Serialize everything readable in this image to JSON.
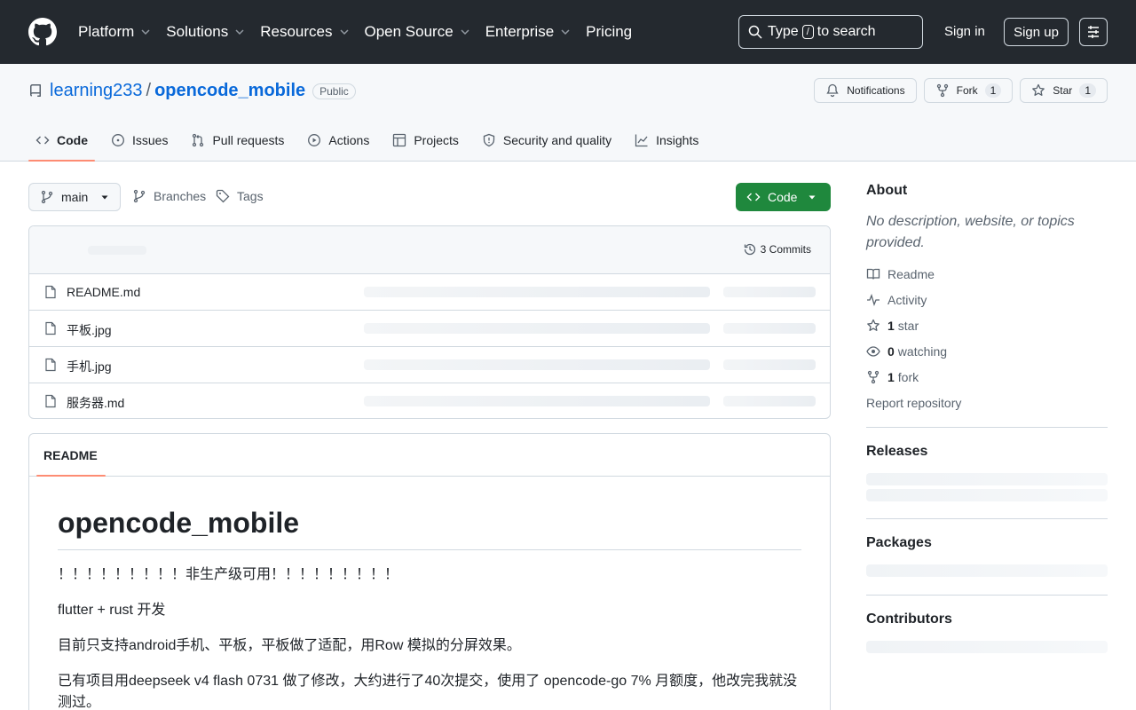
{
  "header": {
    "nav": [
      "Platform",
      "Solutions",
      "Resources",
      "Open Source",
      "Enterprise",
      "Pricing"
    ],
    "nav_has_caret": [
      true,
      true,
      true,
      true,
      true,
      false
    ],
    "search_prefix": "Type",
    "search_key": "/",
    "search_suffix": "to search",
    "sign_in": "Sign in",
    "sign_up": "Sign up"
  },
  "repo": {
    "owner": "learning233",
    "separator": "/",
    "name": "opencode_mobile",
    "visibility": "Public",
    "notifications": "Notifications",
    "fork_label": "Fork",
    "fork_count": "1",
    "star_label": "Star",
    "star_count": "1"
  },
  "tabs": [
    "Code",
    "Issues",
    "Pull requests",
    "Actions",
    "Projects",
    "Security and quality",
    "Insights"
  ],
  "branch": {
    "current": "main",
    "branches": "Branches",
    "tags": "Tags",
    "code_button": "Code"
  },
  "files": {
    "commits": "3 Commits",
    "list": [
      "README.md",
      "平板.jpg",
      "手机.jpg",
      "服务器.md"
    ]
  },
  "readme": {
    "tab": "README",
    "title": "opencode_mobile",
    "paragraphs": [
      "！！！！！！！！！非生产级可用！！！！！！！！！",
      "flutter + rust 开发",
      "目前只支持android手机、平板，平板做了适配，用Row 模拟的分屏效果。",
      "已有项目用deepseek v4 flash 0731 做了修改，大约进行了40次提交，使用了 opencode-go 7% 月额度，他改完我就没测过。"
    ]
  },
  "about": {
    "heading": "About",
    "description": "No description, website, or topics provided.",
    "readme": "Readme",
    "activity": "Activity",
    "stars_count": "1",
    "stars_label": "star",
    "watching_count": "0",
    "watching_label": "watching",
    "forks_count": "1",
    "forks_label": "fork",
    "report": "Report repository"
  },
  "sections": {
    "releases": "Releases",
    "packages": "Packages",
    "contributors": "Contributors"
  },
  "colors": {
    "header_bg": "#24292f",
    "link": "#0969da",
    "code_button": "#1f883d",
    "active_tab_underline": "#fd8c73"
  }
}
